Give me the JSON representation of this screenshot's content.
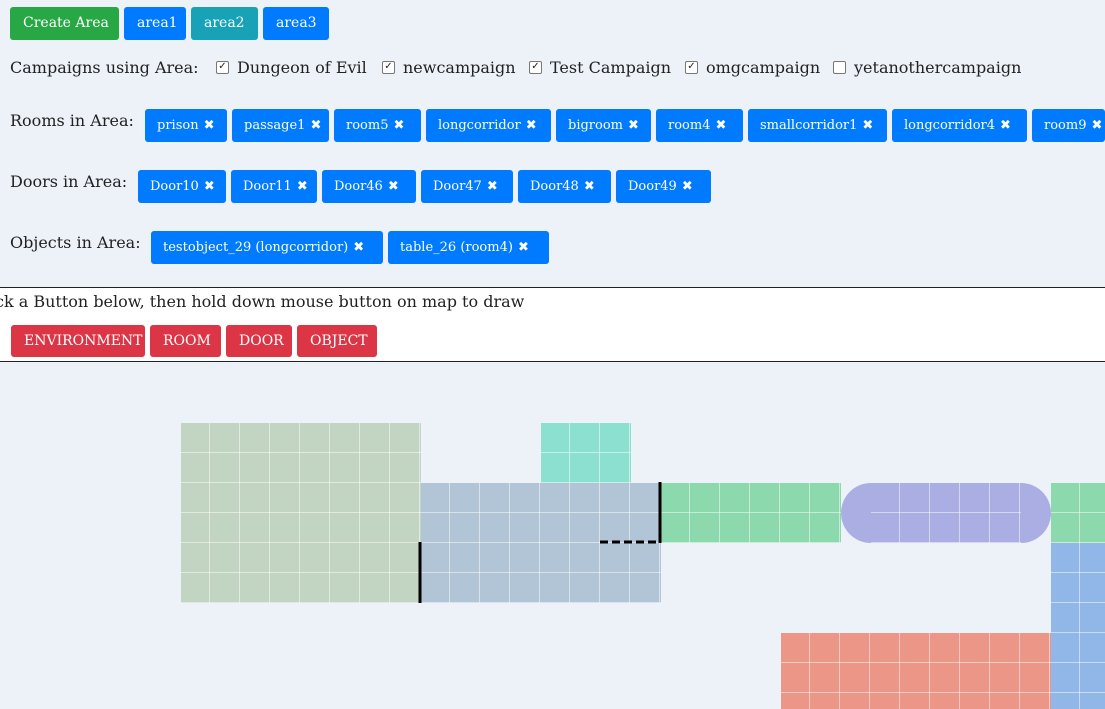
{
  "top_buttons": {
    "create": "Create Area",
    "area1": "area1",
    "area2": "area2",
    "area3": "area3"
  },
  "campaigns": {
    "label": "Campaigns using Area:",
    "items": [
      {
        "name": "Dungeon of Evil",
        "checked": true
      },
      {
        "name": "newcampaign",
        "checked": true
      },
      {
        "name": "Test Campaign",
        "checked": true
      },
      {
        "name": "omgcampaign",
        "checked": true
      },
      {
        "name": "yetanothercampaign",
        "checked": false
      }
    ]
  },
  "rooms": {
    "label": "Rooms in Area:",
    "items": [
      "prison",
      "passage1",
      "room5",
      "longcorridor",
      "bigroom",
      "room4",
      "smallcorridor1",
      "longcorridor4",
      "room9"
    ]
  },
  "doors": {
    "label": "Doors in Area:",
    "items": [
      "Door10",
      "Door11",
      "Door46",
      "Door47",
      "Door48",
      "Door49"
    ]
  },
  "objects": {
    "label": "Objects in Area:",
    "items": [
      "testobject_29 (longcorridor)",
      "table_26 (room4)"
    ]
  },
  "instruction": "ck a Button below, then hold down mouse button on map to draw",
  "draw_buttons": {
    "environment": "ENVIRONMENT",
    "room": "ROOM",
    "door": "DOOR",
    "object": "OBJECT"
  },
  "icons": {
    "remove": "times-icon",
    "check": "checkmark-icon"
  },
  "colors": {
    "green": "#28a745",
    "blue": "#007bff",
    "teal": "#17a2b8",
    "red": "#dc3545",
    "room_sage": "#c2d4c2",
    "room_steel": "#b2c5d6",
    "room_aqua": "#8ce0cf",
    "room_mint": "#8dd9ae",
    "room_lavender": "#abaee3",
    "room_sky": "#91b6e8",
    "room_salmon": "#eb9686"
  }
}
